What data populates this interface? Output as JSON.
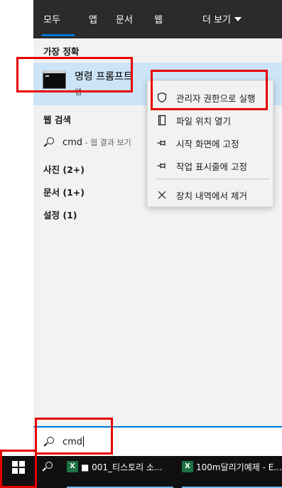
{
  "tabs": [
    {
      "label": "모두"
    },
    {
      "label": "앱"
    },
    {
      "label": "문서"
    },
    {
      "label": "웹"
    },
    {
      "label": "더 보기"
    }
  ],
  "best_match": {
    "heading": "가장 정확",
    "name": "명령 프롬프트",
    "type": "앱"
  },
  "web_search": {
    "heading": "웹 검색",
    "query": "cmd",
    "suffix": " - 웹 결과 보기"
  },
  "categories": [
    {
      "label": "사진 (2+)"
    },
    {
      "label": "문서 (1+)"
    },
    {
      "label": "설정 (1)"
    }
  ],
  "context_menu": [
    {
      "label": "관리자 권한으로 실행",
      "icon": "shield-icon"
    },
    {
      "label": "파일 위치 열기",
      "icon": "file-location-icon"
    },
    {
      "label": "시작 화면에 고정",
      "icon": "pin-icon"
    },
    {
      "label": "작업 표시줄에 고정",
      "icon": "pin-icon"
    },
    {
      "label": "장치 내역에서 제거",
      "icon": "close-icon"
    }
  ],
  "search_box": {
    "value": "cmd"
  },
  "taskbar": {
    "apps": [
      {
        "label": "■ 001_티스토리 소...",
        "icon": "excel-icon"
      },
      {
        "label": "100m달리기예제 - E...",
        "icon": "excel-icon"
      }
    ]
  },
  "colors": {
    "accent": "#0078d7",
    "tabs_bg": "#2b2b2b",
    "selected_bg": "#cce4f7",
    "panel_bg": "#f2f2f2",
    "taskbar_bg": "#101010",
    "highlight": "#e60000"
  }
}
